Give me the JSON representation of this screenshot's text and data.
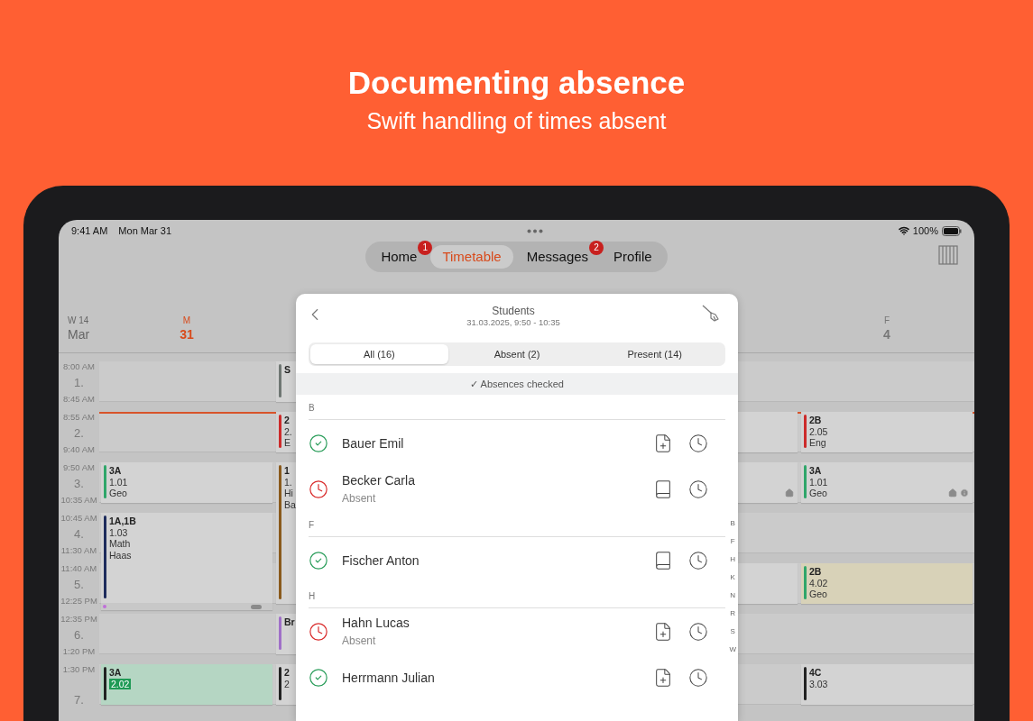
{
  "headline": {
    "title": "Documenting absence",
    "subtitle": "Swift handling of times absent"
  },
  "status_bar": {
    "time": "9:41 AM",
    "date": "Mon Mar 31",
    "battery": "100%"
  },
  "tabs": [
    {
      "label": "Home",
      "selected": false,
      "badge": "1"
    },
    {
      "label": "Timetable",
      "selected": true
    },
    {
      "label": "Messages",
      "selected": false,
      "badge": "2"
    },
    {
      "label": "Profile",
      "selected": false
    }
  ],
  "timetable": {
    "week": "W 14",
    "month": "Mar",
    "periods": [
      {
        "start": "8:00 AM",
        "number": "1.",
        "end": "8:45 AM",
        "now_line": false
      },
      {
        "start": "8:55 AM",
        "number": "2.",
        "end": "9:40 AM",
        "now_line": true
      },
      {
        "start": "9:50 AM",
        "number": "3.",
        "end": "10:35 AM",
        "now_line": false
      },
      {
        "start": "10:45 AM",
        "number": "4.",
        "end": "11:30 AM",
        "now_line": false
      },
      {
        "start": "11:40 AM",
        "number": "5.",
        "end": "12:25 PM",
        "now_line": false
      },
      {
        "start": "12:35 PM",
        "number": "6.",
        "end": "1:20 PM",
        "now_line": false
      },
      {
        "start": "1:30 PM",
        "number": "7.",
        "now_line": false
      }
    ],
    "days": [
      {
        "letter": "M",
        "date": "31",
        "today": true,
        "slots": [
          {
            "kind": "empty"
          },
          {
            "kind": "empty"
          },
          {
            "kind": "lesson",
            "class": "3A",
            "room": "1.01",
            "subject": "Geo",
            "color": "#2fa66a"
          },
          {
            "kind": "lesson",
            "class": "1A,1B",
            "room": "1.03",
            "subject": "Math",
            "teacher": "Haas",
            "color": "#1d2b5c",
            "more": true
          },
          {
            "kind": "continue"
          },
          {
            "kind": "empty"
          },
          {
            "kind": "lesson",
            "class": "3A",
            "room": "2.02",
            "room_changed": true,
            "color": "#222222",
            "background": {
              "color": "#b5d6c3"
            }
          }
        ]
      },
      {
        "slots": [
          {
            "kind": "lesson",
            "class": "S",
            "color": "#6f7773"
          },
          {
            "kind": "lesson",
            "class": "2",
            "room": "2.",
            "subject": "E",
            "color": "#cc2a2a"
          },
          {
            "kind": "lesson",
            "class": "1",
            "room": "1.",
            "subject": "Hi",
            "teacher": "Ba",
            "color": "#8a5a1c"
          },
          {
            "kind": "continue"
          },
          {
            "kind": "continue"
          },
          {
            "kind": "lesson",
            "class": "Br",
            "color": "#a070c8"
          },
          {
            "kind": "lesson",
            "class": "2",
            "room": "2",
            "color": "#222222"
          }
        ]
      },
      {
        "slots": [
          {
            "kind": "empty"
          },
          {
            "kind": "empty"
          },
          {
            "kind": "empty"
          },
          {
            "kind": "empty"
          },
          {
            "kind": "empty"
          },
          {
            "kind": "empty"
          },
          {
            "kind": "empty"
          }
        ]
      },
      {
        "slots": [
          {
            "kind": "empty"
          },
          {
            "kind": "lesson"
          },
          {
            "kind": "lesson",
            "home": true
          },
          {
            "kind": "empty"
          },
          {
            "kind": "lesson"
          },
          {
            "kind": "empty"
          },
          {
            "kind": "empty"
          }
        ]
      },
      {
        "letter": "F",
        "date": "4",
        "today": false,
        "slots": [
          {
            "kind": "empty"
          },
          {
            "kind": "lesson",
            "class": "2B",
            "room": "2.05",
            "subject": "Eng",
            "color": "#cc2a2a"
          },
          {
            "kind": "lesson",
            "class": "3A",
            "room": "1.01",
            "subject": "Geo",
            "color": "#2fa66a",
            "home": true,
            "info": true
          },
          {
            "kind": "empty"
          },
          {
            "kind": "lesson",
            "class": "2B",
            "room": "4.02",
            "subject": "Geo",
            "color": "#2fa66a",
            "background": {
              "color": "#d8d2b8"
            }
          },
          {
            "kind": "empty"
          },
          {
            "kind": "lesson",
            "class": "4C",
            "room": "3.03",
            "color": "#222222"
          }
        ]
      }
    ]
  },
  "students_sheet": {
    "title": "Students",
    "subtitle": "31.03.2025, 9:50 - 10:35",
    "filters": [
      {
        "label": "All (16)",
        "selected": true
      },
      {
        "label": "Absent (2)",
        "selected": false
      },
      {
        "label": "Present (14)",
        "selected": false
      }
    ],
    "banner": "✓ Absences checked",
    "sections": [
      {
        "letter": "B",
        "students": [
          {
            "name": "Bauer Emil",
            "absent": false,
            "note": {
              "kind": "add"
            }
          },
          {
            "name": "Becker Carla",
            "absent": true,
            "status": "Absent",
            "note": {
              "kind": "book"
            }
          }
        ]
      },
      {
        "letter": "F",
        "students": [
          {
            "name": "Fischer Anton",
            "absent": false,
            "note": {
              "kind": "book"
            }
          }
        ]
      },
      {
        "letter": "H",
        "students": [
          {
            "name": "Hahn Lucas",
            "absent": true,
            "status": "Absent",
            "note": {
              "kind": "add"
            }
          },
          {
            "name": "Herrmann Julian",
            "absent": false,
            "note": {
              "kind": "add"
            }
          }
        ]
      }
    ],
    "index": [
      "B",
      "F",
      "H",
      "K",
      "N",
      "R",
      "S",
      "W"
    ]
  }
}
